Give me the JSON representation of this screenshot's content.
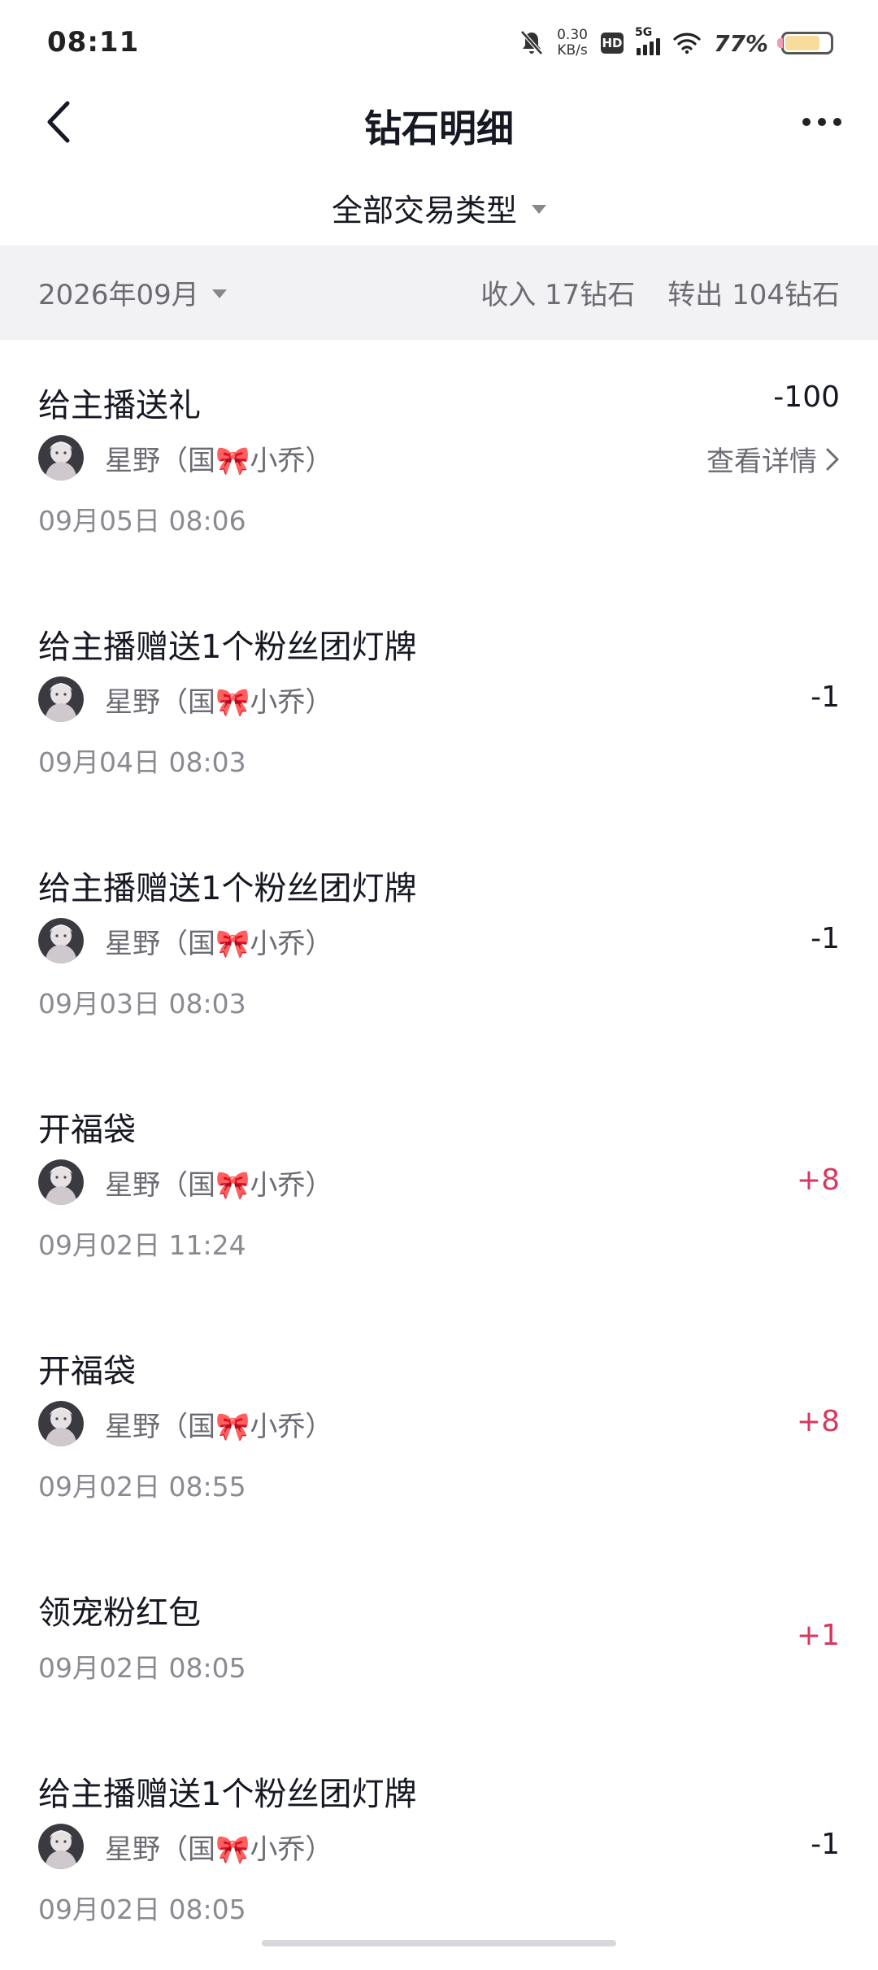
{
  "status_bar": {
    "time": "08:11",
    "net_speed_value": "0.30",
    "net_speed_unit": "KB/s",
    "hd_label": "HD",
    "network": "5G",
    "battery_percent": "77%",
    "battery_level": 0.77
  },
  "header": {
    "title": "钻石明细",
    "back_icon": "chevron-left-icon",
    "more_icon": "more-dots-icon"
  },
  "filter": {
    "label": "全部交易类型"
  },
  "summary": {
    "month": "2026年09月",
    "income": "收入 17钻石",
    "outgoing": "转出 104钻石"
  },
  "transactions": [
    {
      "title": "给主播送礼",
      "user": "星野（国🎀小乔）",
      "time": "09月05日 08:06",
      "amount": "-100",
      "detail": "查看详情"
    },
    {
      "title": "给主播赠送1个粉丝团灯牌",
      "user": "星野（国🎀小乔）",
      "time": "09月04日 08:03",
      "amount": "-1"
    },
    {
      "title": "给主播赠送1个粉丝团灯牌",
      "user": "星野（国🎀小乔）",
      "time": "09月03日 08:03",
      "amount": "-1"
    },
    {
      "title": "开福袋",
      "user": "星野（国🎀小乔）",
      "time": "09月02日 11:24",
      "amount": "+8"
    },
    {
      "title": "开福袋",
      "user": "星野（国🎀小乔）",
      "time": "09月02日 08:55",
      "amount": "+8"
    },
    {
      "title": "领宠粉红包",
      "time": "09月02日 08:05",
      "amount": "+1"
    },
    {
      "title": "给主播赠送1个粉丝团灯牌",
      "user": "星野（国🎀小乔）",
      "time": "09月02日 08:05",
      "amount": "-1"
    }
  ],
  "colors": {
    "text_primary": "#161823",
    "text_secondary": "#6b6b73",
    "summary_bg": "#f2f2f4",
    "positive_amount": "#d8385f"
  }
}
